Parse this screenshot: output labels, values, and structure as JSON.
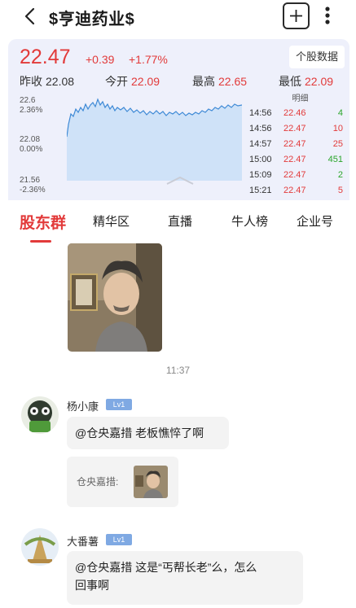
{
  "header": {
    "title": "$亨迪药业$"
  },
  "quote": {
    "price": "22.47",
    "change": "+0.39",
    "change_pct": "+1.77%",
    "stock_data_label": "个股数据",
    "stats": [
      {
        "label": "昨收",
        "value": "22.08"
      },
      {
        "label": "今开",
        "value": "22.09"
      },
      {
        "label": "最高",
        "value": "22.65"
      },
      {
        "label": "最低",
        "value": "22.09"
      }
    ],
    "axis": {
      "top_price": "22.6",
      "top_pct": "2.36%",
      "mid_price": "22.08",
      "mid_pct": "0.00%",
      "bot_price": "21.56",
      "bot_pct": "-2.36%"
    },
    "ticks_header": "明细",
    "ticks": [
      {
        "time": "14:56",
        "price": "22.46",
        "qty": "4",
        "color": "#2aa52a"
      },
      {
        "time": "14:56",
        "price": "22.47",
        "qty": "10",
        "color": "#e23a3a"
      },
      {
        "time": "14:57",
        "price": "22.47",
        "qty": "25",
        "color": "#e23a3a"
      },
      {
        "time": "15:00",
        "price": "22.47",
        "qty": "451",
        "color": "#2aa52a"
      },
      {
        "time": "15:09",
        "price": "22.47",
        "qty": "2",
        "color": "#2aa52a"
      },
      {
        "time": "15:21",
        "price": "22.47",
        "qty": "5",
        "color": "#e23a3a"
      }
    ],
    "colors": {
      "up": "#e23a3a",
      "down": "#2aa52a",
      "panel": "#eef0fb",
      "line": "#3f8ad6",
      "fill": "#cfe2f8"
    }
  },
  "tabs": [
    "股东群",
    "精华区",
    "直播",
    "牛人榜",
    "企业号"
  ],
  "chat": {
    "timestamp": "11:37",
    "messages": [
      {
        "user": "杨小康",
        "level": "Lv1",
        "text": "@仓央嘉措 老板憔悴了啊",
        "quote_label": "仓央嘉措:"
      },
      {
        "user": "大番薯",
        "level": "Lv1",
        "text_line1": "@仓央嘉措 这是“丐帮长老”么，怎么",
        "text_line2": "回事啊"
      }
    ]
  }
}
